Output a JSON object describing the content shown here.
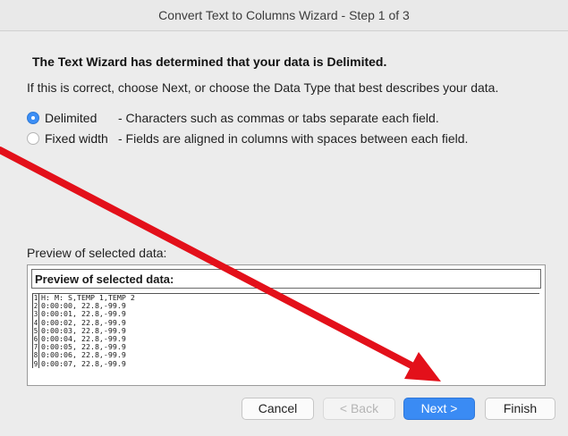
{
  "window": {
    "title": "Convert Text to Columns Wizard - Step 1 of 3"
  },
  "wizard": {
    "heading": "The Text Wizard has determined that your data is Delimited.",
    "subtext": "If this is correct, choose Next, or choose the Data Type that best describes your data.",
    "data_type": {
      "selected": "Delimited",
      "options": [
        {
          "label": "Delimited",
          "description": "- Characters such as commas or tabs separate each field."
        },
        {
          "label": "Fixed width",
          "description": "- Fields are aligned in columns with spaces between each field."
        }
      ]
    },
    "preview": {
      "label": "Preview of selected data:",
      "header": "Preview of selected data:",
      "lines": [
        {
          "n": "1",
          "text": "H: M: S,TEMP 1,TEMP 2"
        },
        {
          "n": "2",
          "text": "0:00:00, 22.8,-99.9"
        },
        {
          "n": "3",
          "text": "0:00:01, 22.8,-99.9"
        },
        {
          "n": "4",
          "text": "0:00:02, 22.8,-99.9"
        },
        {
          "n": "5",
          "text": "0:00:03, 22.8,-99.9"
        },
        {
          "n": "6",
          "text": "0:00:04, 22.8,-99.9"
        },
        {
          "n": "7",
          "text": "0:00:05, 22.8,-99.9"
        },
        {
          "n": "8",
          "text": "0:00:06, 22.8,-99.9"
        },
        {
          "n": "9",
          "text": "0:00:07, 22.8,-99.9"
        }
      ]
    },
    "buttons": {
      "cancel": "Cancel",
      "back": "< Back",
      "next": "Next >",
      "finish": "Finish"
    }
  },
  "colors": {
    "accent": "#3a8bf4",
    "annotation_arrow": "#e3101a"
  }
}
